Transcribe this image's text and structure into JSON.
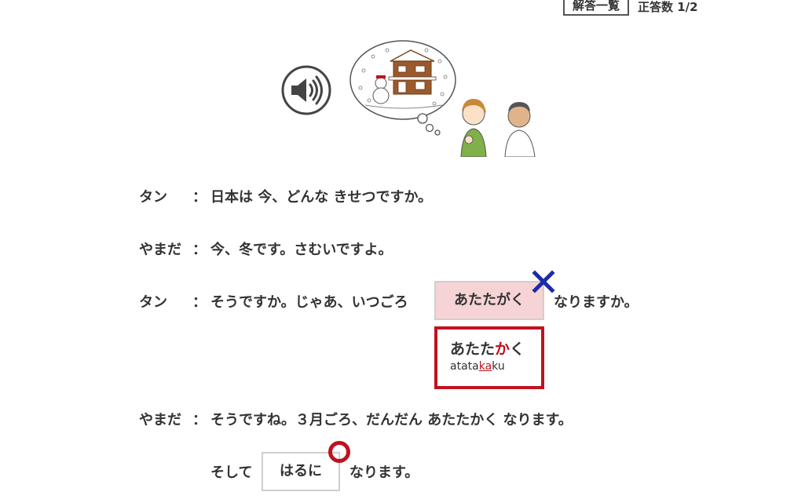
{
  "header": {
    "answer_list_button": "解答一覧",
    "score_label": "正答数 1/2"
  },
  "media": {
    "speaker_icon": "speaker-volume-icon",
    "illustration": "winter-house-thought-bubble-two-people"
  },
  "dialogue": {
    "line1": {
      "speaker": "タン",
      "colon": "：",
      "text": "日本は 今、どんな きせつですか。"
    },
    "line2": {
      "speaker": "やまだ",
      "colon": "：",
      "text": "今、冬です。さむいですよ。"
    },
    "line3": {
      "speaker": "タン",
      "colon": "：",
      "text_before": "そうですか。じゃあ、いつごろ",
      "answer": "あたたがく",
      "answer_status": "incorrect",
      "text_after": "なりますか。"
    },
    "correction": {
      "part1": "あたた",
      "part2": "か",
      "part3": "く",
      "romaji1": "atata",
      "romaji2": "ka",
      "romaji3": "ku"
    },
    "line4": {
      "speaker": "やまだ",
      "colon": "：",
      "text": "そうですね。３月ごろ、だんだん あたたかく なります。"
    },
    "line5": {
      "text_before": "そして",
      "answer": "はるに",
      "answer_status": "correct",
      "text_after": "なります。"
    }
  },
  "colors": {
    "incorrect_bg": "#f6d3d5",
    "incorrect_mark": "#1d2aa8",
    "correct_mark": "#c0121e",
    "correction_border": "#c0121e"
  }
}
